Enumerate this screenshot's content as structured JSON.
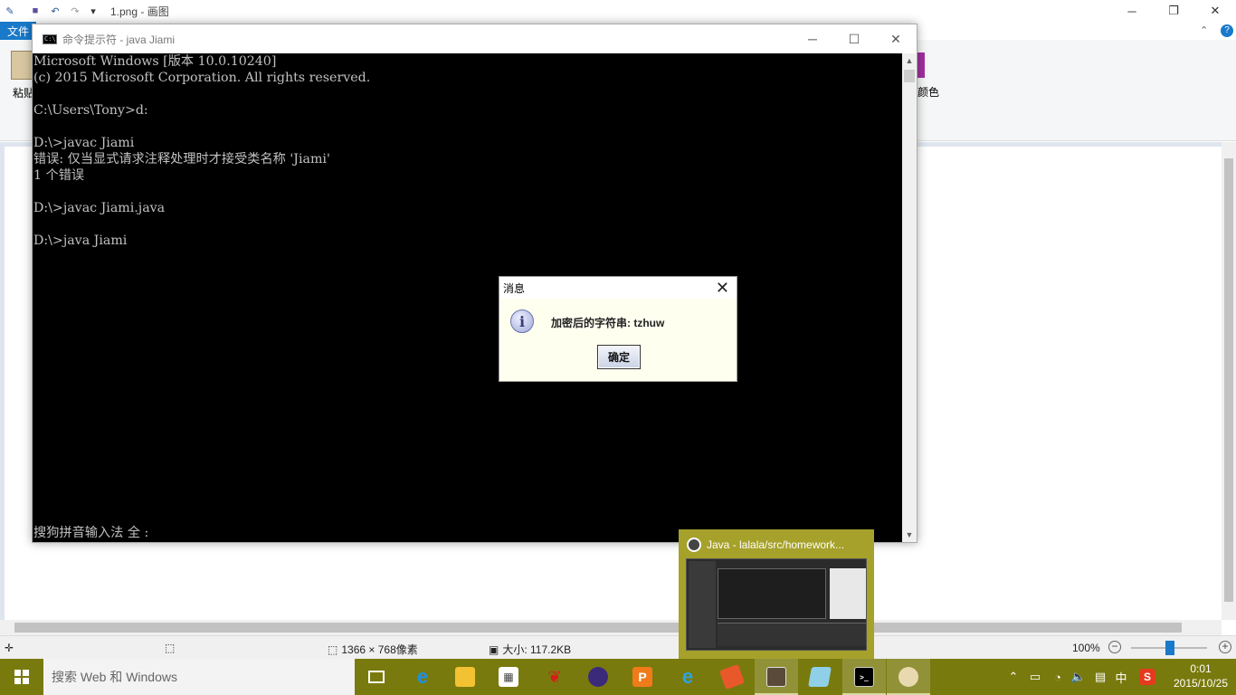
{
  "paint": {
    "title": "1.png - 画图",
    "file_tab": "文件",
    "paste_label": "粘贴",
    "color_label": "颜色",
    "status": {
      "dimensions": "1366 × 768像素",
      "size": "大小: 117.2KB",
      "zoom": "100%"
    }
  },
  "cmd": {
    "title": "命令提示符 - java  Jiami",
    "lines": [
      "Microsoft Windows [版本 10.0.10240]",
      "(c) 2015 Microsoft Corporation. All rights reserved.",
      "C:\\Users\\Tony>d:",
      "D:\\>javac Jiami",
      "错误: 仅当显式请求注释处理时才接受类名称 'Jiami'",
      "1 个错误",
      "D:\\>javac Jiami.java",
      "D:\\>java Jiami",
      "搜狗拼音输入法 全 :"
    ]
  },
  "dialog": {
    "title": "消息",
    "message": "加密后的字符串: tzhuw",
    "ok_label": "确定"
  },
  "preview": {
    "title": "Java  -  lalala/src/homework..."
  },
  "taskbar": {
    "search_placeholder": "搜索 Web 和 Windows",
    "ime": "中",
    "time": "0:01",
    "date": "2015/10/25"
  },
  "icons": {
    "start": "windows-logo-icon",
    "task_view": "task-view-icon",
    "edge": "edge-icon",
    "explorer": "file-explorer-icon",
    "store": "store-icon",
    "eclipse": "eclipse-icon",
    "ie": "internet-explorer-icon",
    "java": "java-icon",
    "cmd": "command-prompt-icon",
    "paint": "paint-icon"
  }
}
